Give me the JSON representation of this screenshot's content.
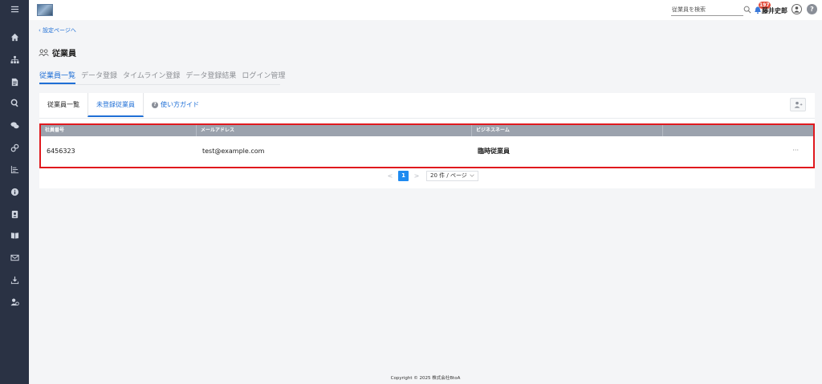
{
  "header": {
    "search_placeholder": "従業員を検索",
    "notification_count": "197",
    "user_name": "藤井史郎",
    "help_label": "?"
  },
  "sidebar": {
    "items": [
      {
        "icon": "menu-icon"
      },
      {
        "icon": "home-icon"
      },
      {
        "icon": "org-chart-icon"
      },
      {
        "icon": "document-icon"
      },
      {
        "icon": "search-icon"
      },
      {
        "icon": "chat-icon"
      },
      {
        "icon": "link-icon"
      },
      {
        "icon": "chart-icon"
      },
      {
        "icon": "info-icon"
      },
      {
        "icon": "contact-card-icon"
      },
      {
        "icon": "book-icon"
      },
      {
        "icon": "mail-icon"
      },
      {
        "icon": "download-icon"
      },
      {
        "icon": "user-settings-icon"
      }
    ]
  },
  "breadcrumb": {
    "back_label": "設定ページへ"
  },
  "page": {
    "title": "従業員"
  },
  "top_tabs": [
    {
      "label": "従業員一覧",
      "active": true
    },
    {
      "label": "データ登録",
      "active": false
    },
    {
      "label": "タイムライン登録",
      "active": false
    },
    {
      "label": "データ登録結果",
      "active": false
    },
    {
      "label": "ログイン管理",
      "active": false
    }
  ],
  "sub_tabs": [
    {
      "label": "従業員一覧",
      "active": false
    },
    {
      "label": "未登録従業員",
      "active": true
    },
    {
      "label": "使い方ガイド",
      "active": false
    }
  ],
  "table": {
    "headers": [
      "社員番号",
      "メールアドレス",
      "ビジネスネーム",
      ""
    ],
    "rows": [
      {
        "employee_id": "6456323",
        "email": "test@example.com",
        "business_name": "臨時従業員",
        "more": "···"
      }
    ]
  },
  "pagination": {
    "prev": "<",
    "current_page": "1",
    "next": ">",
    "page_size": "20 件 / ページ"
  },
  "footer": {
    "copyright": "Copyright © 2025 株式会社BtoA"
  },
  "colors": {
    "sidebar_bg": "#2a3244",
    "accent": "#1f6fd6",
    "table_header_bg": "#9ba2ad",
    "highlight_border": "#e0191e",
    "badge_bg": "#e34b3b"
  }
}
